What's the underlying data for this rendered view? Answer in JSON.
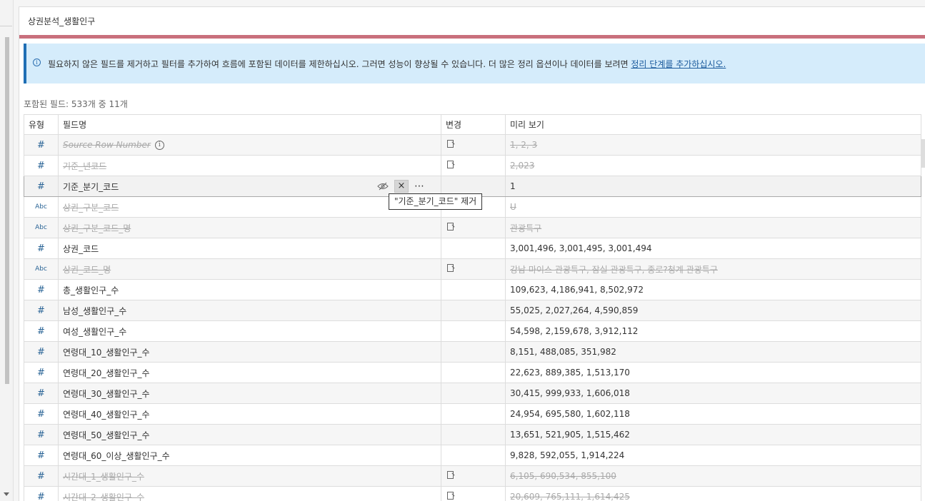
{
  "panel": {
    "title": "상권분석_생활인구"
  },
  "colors": {
    "flow_bar": "#c9707d",
    "banner_bg": "#d5ecfb",
    "banner_border": "#1f6fb5",
    "link": "#1a5a9c"
  },
  "banner": {
    "text": "필요하지 않은 필드를 제거하고 필터를 추가하여 흐름에 포함된 데이터를 제한하십시오. 그러면 성능이 향상될 수 있습니다. 더 많은 정리 옵션이나 데이터를 보려면 ",
    "link": "정리 단계를 추가하십시오.",
    "icon": "info-icon"
  },
  "fields_count": "포함된 필드: 533개 중 11개",
  "table": {
    "headers": {
      "type": "유형",
      "name": "필드명",
      "change": "변경",
      "preview": "미리 보기"
    },
    "rows": [
      {
        "type": "#",
        "name": "Source Row Number",
        "preview": "1, 2, 3",
        "removed": true,
        "changed": true
      },
      {
        "type": "#",
        "name": "기준_년코드",
        "preview": "2,023",
        "removed": true,
        "changed": true
      },
      {
        "type": "#",
        "name": "기준_분기_코드",
        "preview": "1",
        "removed": false,
        "changed": false
      },
      {
        "type": "Abc",
        "name": "상권_구분_코드",
        "preview": "U",
        "removed": true,
        "changed": false
      },
      {
        "type": "Abc",
        "name": "상권_구분_코드_명",
        "preview": "관광특구",
        "removed": true,
        "changed": true
      },
      {
        "type": "#",
        "name": "상권_코드",
        "preview": "3,001,496, 3,001,495, 3,001,494",
        "removed": false,
        "changed": false
      },
      {
        "type": "Abc",
        "name": "상권_코드_명",
        "preview": "강남 마이스 관광특구, 잠실 관광특구, 종로?청계 관광특구",
        "removed": true,
        "changed": true
      },
      {
        "type": "#",
        "name": "총_생활인구_수",
        "preview": "109,623, 4,186,941, 8,502,972",
        "removed": false,
        "changed": false
      },
      {
        "type": "#",
        "name": "남성_생활인구_수",
        "preview": "55,025, 2,027,264, 4,590,859",
        "removed": false,
        "changed": false
      },
      {
        "type": "#",
        "name": "여성_생활인구_수",
        "preview": "54,598, 2,159,678, 3,912,112",
        "removed": false,
        "changed": false
      },
      {
        "type": "#",
        "name": "연령대_10_생활인구_수",
        "preview": "8,151, 488,085, 351,982",
        "removed": false,
        "changed": false
      },
      {
        "type": "#",
        "name": "연령대_20_생활인구_수",
        "preview": "22,623, 889,385, 1,513,170",
        "removed": false,
        "changed": false
      },
      {
        "type": "#",
        "name": "연령대_30_생활인구_수",
        "preview": "30,415, 999,933, 1,606,018",
        "removed": false,
        "changed": false
      },
      {
        "type": "#",
        "name": "연령대_40_생활인구_수",
        "preview": "24,954, 695,580, 1,602,118",
        "removed": false,
        "changed": false
      },
      {
        "type": "#",
        "name": "연령대_50_생활인구_수",
        "preview": "13,651, 521,905, 1,515,462",
        "removed": false,
        "changed": false
      },
      {
        "type": "#",
        "name": "연령대_60_이상_생활인구_수",
        "preview": "9,828, 592,055, 1,914,224",
        "removed": false,
        "changed": false
      },
      {
        "type": "#",
        "name": "시간대_1_생활인구_수",
        "preview": "6,105, 690,534, 855,100",
        "removed": true,
        "changed": true
      },
      {
        "type": "#",
        "name": "시간대_2_생활인구_수",
        "preview": "20,609, 765,111, 1,614,425",
        "removed": true,
        "changed": true
      }
    ]
  },
  "row_actions": {
    "x_label": "×",
    "more_label": "⋯",
    "hide_icon": "eye-slash-icon"
  },
  "tooltip": "\"기준_분기_코드\" 제거"
}
